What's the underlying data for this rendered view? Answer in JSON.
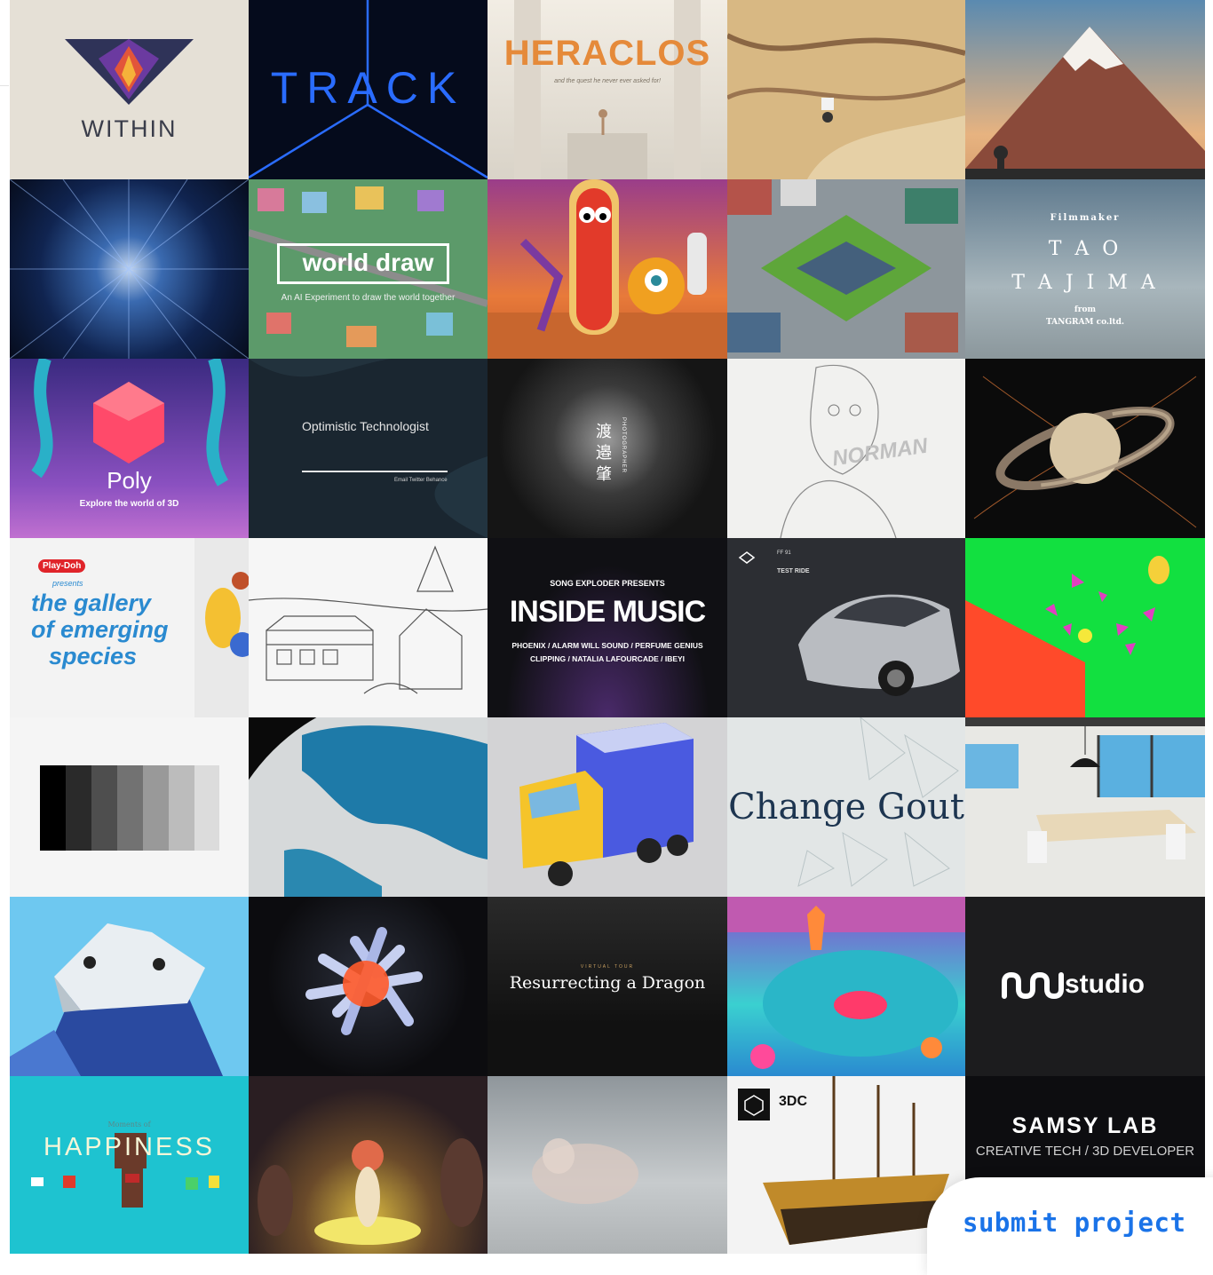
{
  "tiles": [
    {
      "name": "within",
      "bg": "#e5e0d6",
      "title": "WITHIN"
    },
    {
      "name": "track",
      "bg": "#050b1c",
      "title": "TRACK"
    },
    {
      "name": "heraclos",
      "bg": "#eae4da",
      "title": "HERACLOS",
      "subtitle": "and the quest he never ever asked for!"
    },
    {
      "name": "desert-robot",
      "bg": "#d8b883"
    },
    {
      "name": "mountain",
      "bg": "#dba070"
    },
    {
      "name": "starfield",
      "bg": "#0a1630"
    },
    {
      "name": "world-draw",
      "bg": "#5c9a6a",
      "title": "world draw",
      "subtitle": "An AI Experiment to draw the world together"
    },
    {
      "name": "hotdog",
      "bg": "#b03a78"
    },
    {
      "name": "city-block",
      "bg": "#8d969c"
    },
    {
      "name": "tao-tajima",
      "bg": "#7e93a2",
      "kicker": "Filmmaker",
      "line1": "T A O",
      "line2": "T A J I M A",
      "from": "from",
      "studio": "TANGRAM co.ltd."
    },
    {
      "name": "poly",
      "bg": "#4a3590",
      "title": "Poly",
      "subtitle": "Explore the world of 3D"
    },
    {
      "name": "optimistic-technologist",
      "bg": "#1a2630",
      "title": "Optimistic Technologist",
      "links": "Email   Twitter   Behance"
    },
    {
      "name": "photographer",
      "bg": "#151515",
      "kanji1": "渡",
      "kanji2": "邉",
      "kanji3": "肇",
      "vertical": "PHOTOGRAPHER"
    },
    {
      "name": "norman",
      "bg": "#f1f1ef",
      "title": "NORMAN"
    },
    {
      "name": "saturn",
      "bg": "#0b0b0b"
    },
    {
      "name": "gallery-emerging-species",
      "bg": "#f3f3f3",
      "brand": "Play-Doh",
      "presents": "presents",
      "line1": "the gallery",
      "line2": "of emerging",
      "line3": "species"
    },
    {
      "name": "sketch-train",
      "bg": "#f6f6f6"
    },
    {
      "name": "inside-music",
      "bg": "#101014",
      "kicker": "SONG EXPLODER PRESENTS",
      "title": "INSIDE MUSIC",
      "artists1": "PHOENIX / ALARM WILL SOUND / PERFUME GENIUS",
      "artists2": "CLIPPING / NATALIA LAFOURCADE / IBEYI"
    },
    {
      "name": "ff91",
      "bg": "#2c2e33",
      "model": "FF 91",
      "label": "TEST RIDE"
    },
    {
      "name": "green-room",
      "bg": "#12e040"
    },
    {
      "name": "grayscale",
      "bg": "#f5f5f5"
    },
    {
      "name": "globe",
      "bg": "#0a0a0a"
    },
    {
      "name": "transmit-truck",
      "bg": "#d3d3d5"
    },
    {
      "name": "change-gout",
      "bg": "#e2e6e6",
      "title": "Change Gout"
    },
    {
      "name": "interior",
      "bg": "#e8e8e4"
    },
    {
      "name": "blue-creature",
      "bg": "#6ec8f0"
    },
    {
      "name": "red-structure",
      "bg": "#0c0c0f"
    },
    {
      "name": "resurrecting-dragon",
      "bg": "#1a1a1a",
      "kicker": "VIRTUAL TOUR",
      "title": "Resurrecting a Dragon"
    },
    {
      "name": "pinball",
      "bg": "#6a3aa0"
    },
    {
      "name": "nu-studio",
      "bg": "#1c1c1e",
      "title": "studio"
    },
    {
      "name": "happiness",
      "bg": "#1ec3d0",
      "kicker": "Moments of",
      "title": "HAPPINESS"
    },
    {
      "name": "forest-creature",
      "bg": "#3b2a2a"
    },
    {
      "name": "point-cloud",
      "bg": "#b9bfc3"
    },
    {
      "name": "ship-3dc",
      "bg": "#f3f3f3",
      "badge": "3DC"
    },
    {
      "name": "samsy-lab",
      "bg": "#0d0d10",
      "title": "SAMSY LAB",
      "subtitle": "CREATIVE TECH / 3D DEVELOPER"
    }
  ],
  "submit": {
    "label": "submit project"
  }
}
